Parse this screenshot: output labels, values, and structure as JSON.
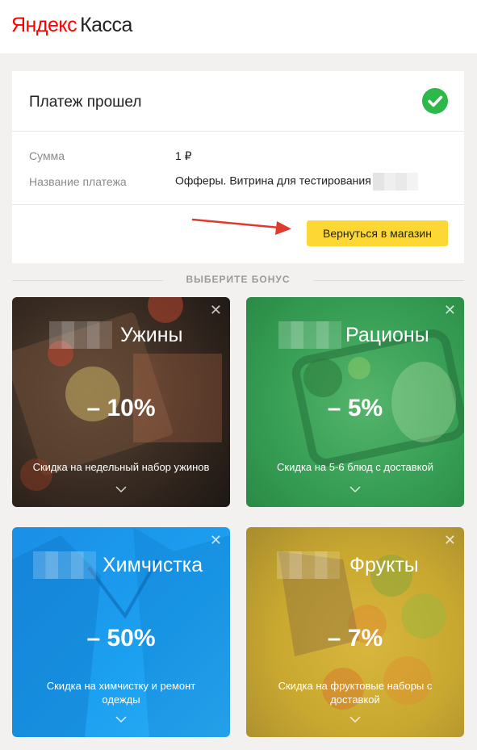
{
  "header": {
    "logo_yandex": "Яндекс",
    "logo_kassa": "Касса"
  },
  "payment": {
    "title": "Платеж прошел",
    "amount_label": "Сумма",
    "amount_value": "1 ₽",
    "name_label": "Название платежа",
    "name_value": "Офферы. Витрина для тестирования",
    "return_button": "Вернуться в магазин",
    "status_color": "#2fb84a"
  },
  "bonus": {
    "heading": "ВЫБЕРИТЕ БОНУС",
    "tiles": [
      {
        "name": "Ужины",
        "discount": "– 10%",
        "description": "Скидка на недельный набор ужинов",
        "color": "#3a2c22"
      },
      {
        "name": "Рационы",
        "discount": "– 5%",
        "description": "Скидка на 5-6 блюд с доставкой",
        "color": "#38a056"
      },
      {
        "name": "Химчистка",
        "discount": "– 50%",
        "description": "Скидка на химчистку и ремонт одежды",
        "color": "#1ca0f0"
      },
      {
        "name": "Фрукты",
        "discount": "– 7%",
        "description": "Скидка на фруктовые наборы с доставкой",
        "color": "#c9a830"
      }
    ]
  },
  "colors": {
    "button_accent": "#fdd835",
    "logo_red": "#ff0000"
  }
}
